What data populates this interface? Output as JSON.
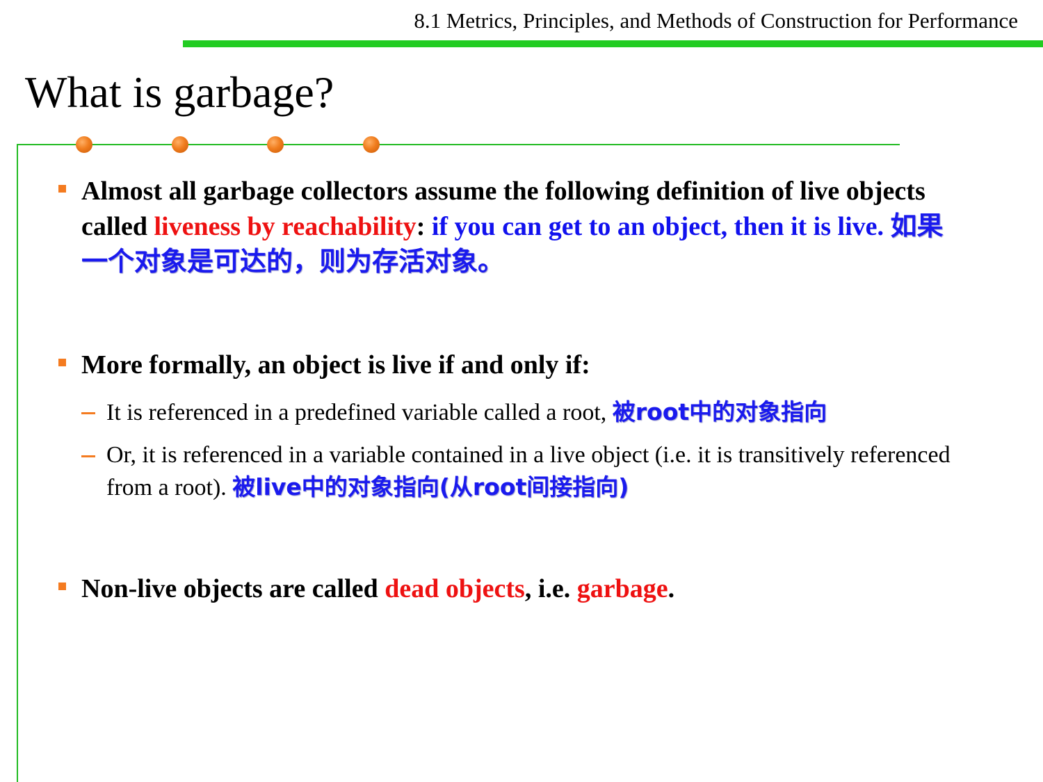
{
  "header": {
    "section_title": "8.1 Metrics, Principles, and Methods of Construction for Performance"
  },
  "slide": {
    "title": "What is garbage?"
  },
  "bullets": [
    {
      "p1": "Almost all garbage collectors assume the following definition of live objects called ",
      "p2": "liveness by reachability",
      "p3": ": ",
      "p4": "if you can get to an object, then it is live.",
      "p5": " ",
      "p6": "如果一个对象是可达的，则为存活对象。"
    },
    {
      "p1": "More formally, an object is live if and only if:"
    },
    {
      "p1": "Non-live objects are called ",
      "p2": "dead objects",
      "p3": ", i.e. ",
      "p4": "garbage",
      "p5": "."
    }
  ],
  "subbullets": [
    {
      "p1": "It is referenced in a predefined variable called a root, ",
      "p2": "被root中的对象指向"
    },
    {
      "p1": "Or, it is referenced in a variable contained in a live object (i.e. it is transitively referenced from a root).  ",
      "p2": "被live中的对象指向(从root间接指向)"
    }
  ],
  "colors": {
    "header_rule": "#22cc22",
    "frame": "#22bb22",
    "bullet_marker": "#f47b20",
    "dot": "#f07d1e",
    "emphasis_red": "#ee1111",
    "emphasis_blue": "#1111ee"
  }
}
